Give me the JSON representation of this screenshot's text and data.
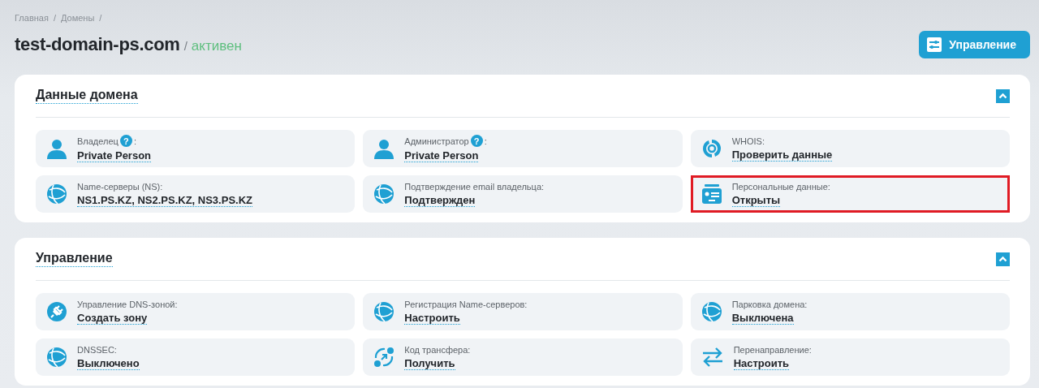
{
  "breadcrumbs": [
    "Главная",
    "Домены"
  ],
  "breadcrumb_separator": "/",
  "title": {
    "domain": "test-domain-ps.com",
    "separator": "/",
    "status": "активен"
  },
  "header_button": {
    "label": "Управление"
  },
  "sections": [
    {
      "title": "Данные домена",
      "expanded": true,
      "tiles": [
        {
          "kind": "person",
          "label": "Владелец",
          "help": "?",
          "label_suffix": ":",
          "value": "Private Person",
          "highlighted": false
        },
        {
          "kind": "person",
          "label": "Администратор",
          "help": "?",
          "label_suffix": ":",
          "value": "Private Person",
          "highlighted": false
        },
        {
          "kind": "whois",
          "label": "WHOIS:",
          "value": "Проверить данные",
          "highlighted": false
        },
        {
          "kind": "globe",
          "label": "Name-серверы (NS):",
          "value": "NS1.PS.KZ, NS2.PS.KZ, NS3.PS.KZ",
          "highlighted": false
        },
        {
          "kind": "globe",
          "label": "Подтверждение email владельца:",
          "value": "Подтвержден",
          "highlighted": false
        },
        {
          "kind": "card",
          "label": "Персональные данные:",
          "value": "Открыты",
          "highlighted": true
        }
      ]
    },
    {
      "title": "Управление",
      "expanded": true,
      "tiles": [
        {
          "kind": "plug",
          "label": "Управление DNS-зоной:",
          "value": "Создать зону",
          "highlighted": false
        },
        {
          "kind": "globe",
          "label": "Регистрация Name-серверов:",
          "value": "Настроить",
          "highlighted": false
        },
        {
          "kind": "globe",
          "label": "Парковка домена:",
          "value": "Выключена",
          "highlighted": false
        },
        {
          "kind": "globe",
          "label": "DNSSEC:",
          "value": "Выключено",
          "highlighted": false
        },
        {
          "kind": "transfer",
          "label": "Код трансфера:",
          "value": "Получить",
          "highlighted": false
        },
        {
          "kind": "arrows",
          "label": "Перенаправление:",
          "value": "Настроить",
          "highlighted": false
        }
      ]
    }
  ]
}
